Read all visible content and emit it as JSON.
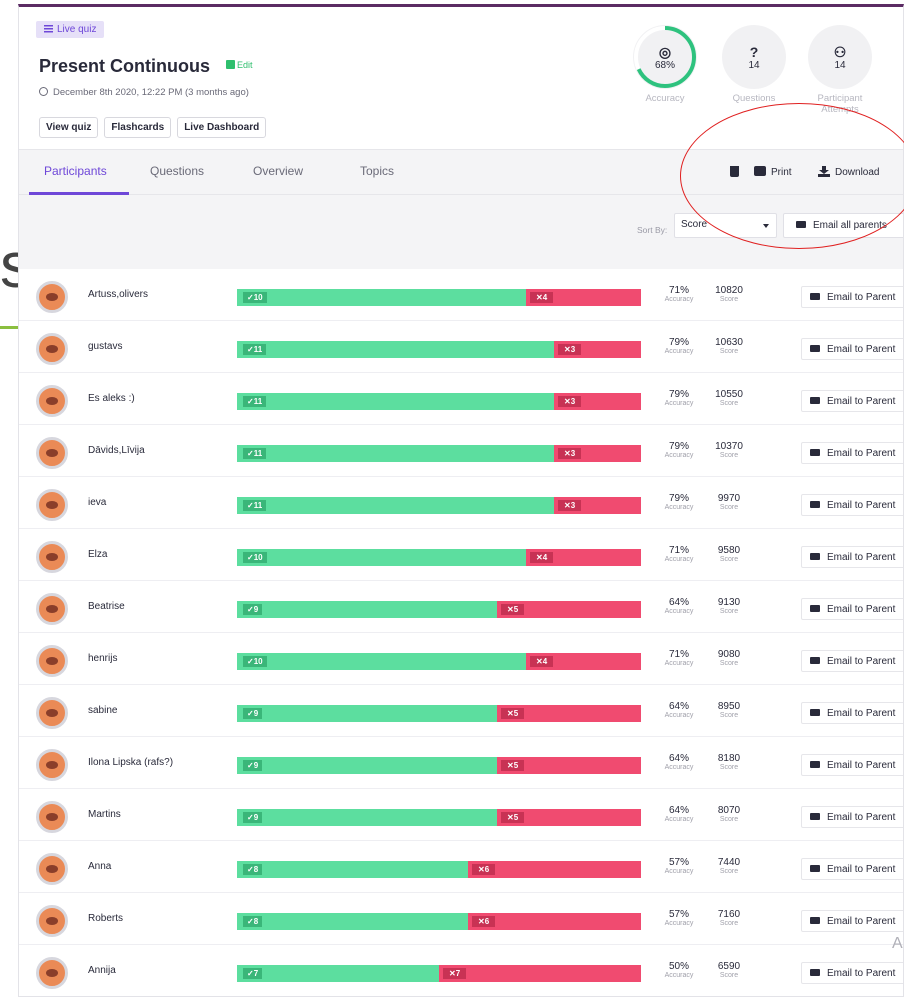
{
  "quiz": {
    "badge": "Live quiz",
    "title": "Present Continuous",
    "edit_label": "Edit",
    "date": "December 8th 2020, 12:22 PM (3 months ago)",
    "buttons": [
      "View quiz",
      "Flashcards",
      "Live Dashboard"
    ]
  },
  "stats": {
    "accuracy": {
      "value": "68%",
      "label": "Accuracy",
      "fraction": 0.68
    },
    "questions": {
      "value": "14",
      "label": "Questions",
      "icon": "question-icon"
    },
    "attempts": {
      "value": "14",
      "label": "Participant Attempts",
      "icon": "participants-icon"
    }
  },
  "tabs": [
    "Participants",
    "Questions",
    "Overview",
    "Topics"
  ],
  "tools": {
    "print": "Print",
    "download": "Download"
  },
  "sort": {
    "label": "Sort By:",
    "value": "Score"
  },
  "email_all": "Email all parents",
  "email_parent_label": "Email to Parent",
  "accuracy_sub": "Accuracy",
  "score_sub": "Score",
  "colors": {
    "correct": "#5cde9f",
    "incorrect": "#f04b70",
    "accent": "#6e47d8",
    "annotation": "#e02020"
  },
  "participants": [
    {
      "name": "Artuss,olivers",
      "correct": 10,
      "incorrect": 4,
      "accuracy": "71%",
      "score": "10820"
    },
    {
      "name": "gustavs",
      "correct": 11,
      "incorrect": 3,
      "accuracy": "79%",
      "score": "10630"
    },
    {
      "name": "Es aleks :)",
      "correct": 11,
      "incorrect": 3,
      "accuracy": "79%",
      "score": "10550"
    },
    {
      "name": "Dāvids,Līvija",
      "correct": 11,
      "incorrect": 3,
      "accuracy": "79%",
      "score": "10370"
    },
    {
      "name": "ieva",
      "correct": 11,
      "incorrect": 3,
      "accuracy": "79%",
      "score": "9970"
    },
    {
      "name": "Elza",
      "correct": 10,
      "incorrect": 4,
      "accuracy": "71%",
      "score": "9580"
    },
    {
      "name": "Beatrise",
      "correct": 9,
      "incorrect": 5,
      "accuracy": "64%",
      "score": "9130"
    },
    {
      "name": "henrijs",
      "correct": 10,
      "incorrect": 4,
      "accuracy": "71%",
      "score": "9080"
    },
    {
      "name": "sabine",
      "correct": 9,
      "incorrect": 5,
      "accuracy": "64%",
      "score": "8950"
    },
    {
      "name": "Ilona Lipska (rafs?)",
      "correct": 9,
      "incorrect": 5,
      "accuracy": "64%",
      "score": "8180"
    },
    {
      "name": "Martins",
      "correct": 9,
      "incorrect": 5,
      "accuracy": "64%",
      "score": "8070"
    },
    {
      "name": "Anna",
      "correct": 8,
      "incorrect": 6,
      "accuracy": "57%",
      "score": "7440"
    },
    {
      "name": "Roberts",
      "correct": 8,
      "incorrect": 6,
      "accuracy": "57%",
      "score": "7160"
    },
    {
      "name": "Annija",
      "correct": 7,
      "incorrect": 7,
      "accuracy": "50%",
      "score": "6590"
    }
  ]
}
